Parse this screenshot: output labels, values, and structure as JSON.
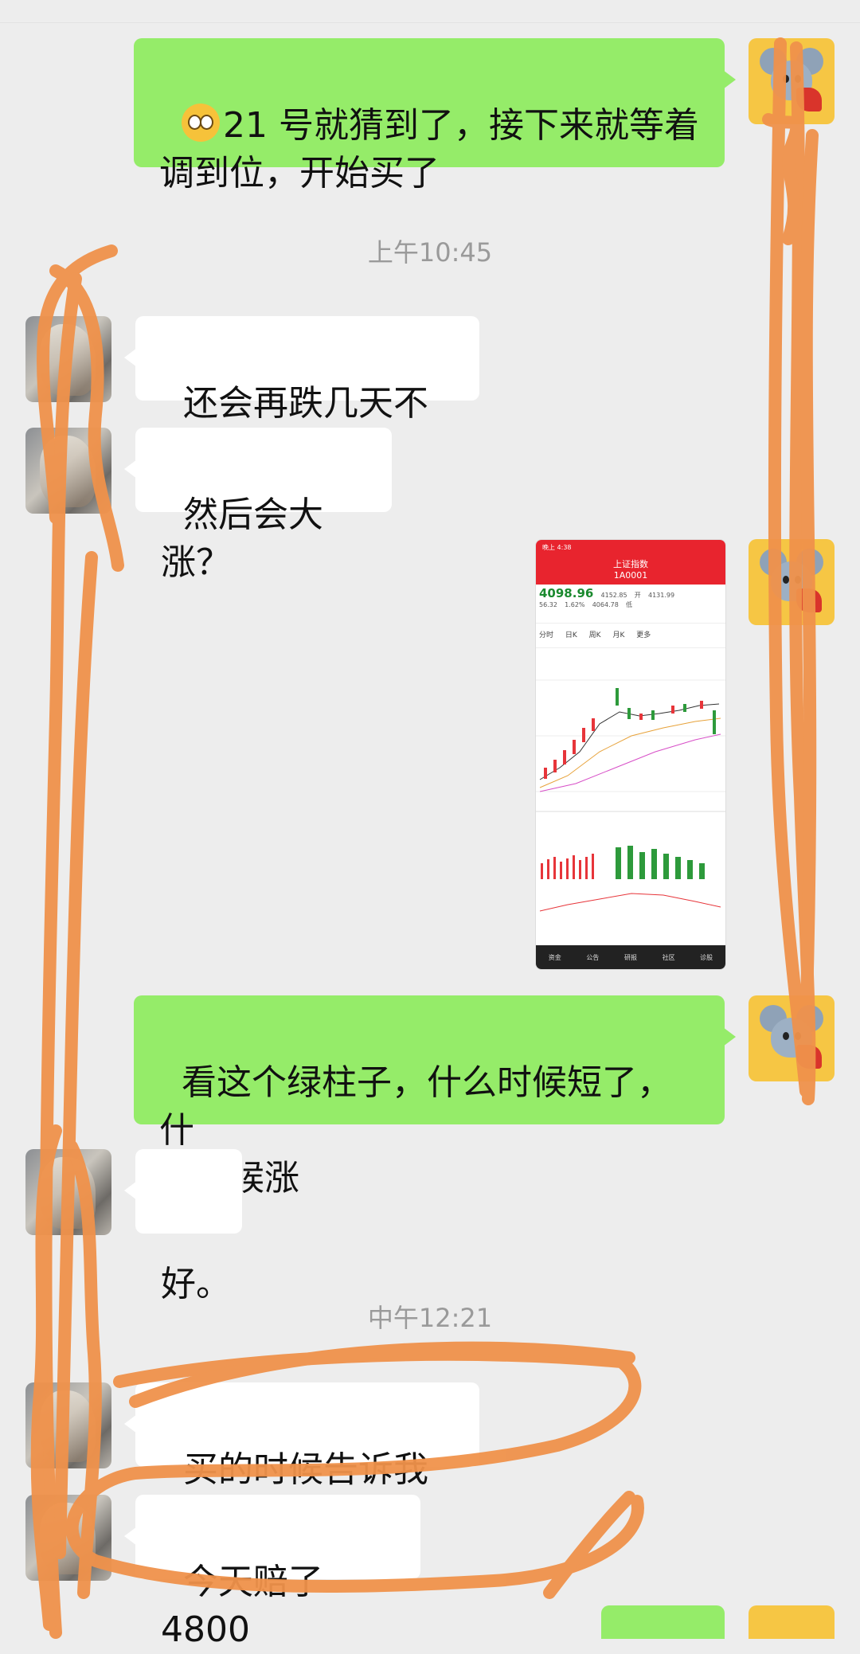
{
  "messages": [
    {
      "side": "right",
      "text": "21 号就猜到了，接下来就等着\n调到位，开始买了",
      "emoji": "flushed-face"
    },
    {
      "type": "time",
      "text": "上午10:45"
    },
    {
      "side": "left",
      "text": "还会再跌几天不是"
    },
    {
      "side": "left",
      "text": "然后会大涨？"
    },
    {
      "side": "right",
      "type": "image"
    },
    {
      "side": "right",
      "text": "看这个绿柱子，什么时候短了，什\n么时候涨"
    },
    {
      "side": "left",
      "text": "好。"
    },
    {
      "type": "time",
      "text": "中午12:21"
    },
    {
      "side": "left",
      "text": "买的时候告诉我啊"
    },
    {
      "side": "left",
      "text": "今天赔了 4800"
    }
  ],
  "screenshot": {
    "status_left": "晚上 4:38",
    "title": "上证指数",
    "subtitle": "1A0001",
    "price": "4098.96",
    "change": "56.32",
    "change_pct": "1.62%",
    "open_label": "开",
    "open": "4131.99",
    "high": "4152.85",
    "low": "4064.78",
    "low_label": "低",
    "tabs": [
      "分时",
      "日K",
      "周K",
      "月K",
      "更多"
    ],
    "footer": [
      "资金",
      "公告",
      "研报",
      "社区",
      "诊股"
    ]
  },
  "colors": {
    "green_bubble": "#95ec69",
    "white_bubble": "#ffffff",
    "background": "#ededed",
    "scribble": "#f0924b"
  }
}
